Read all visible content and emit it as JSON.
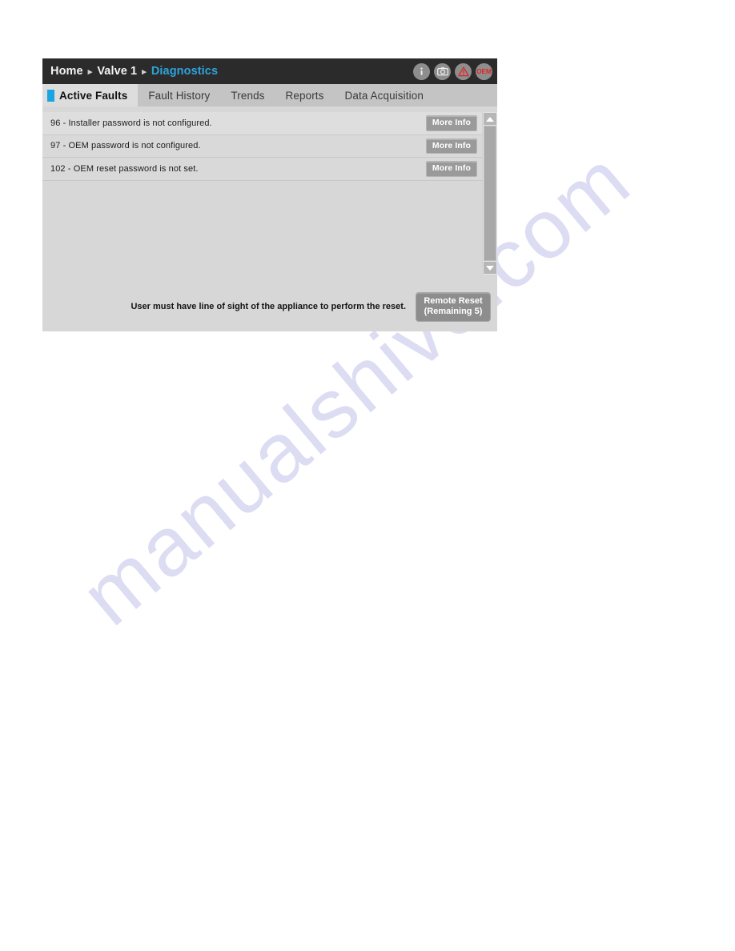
{
  "watermark": {
    "text": "manualshive.com"
  },
  "panel": {
    "breadcrumb": {
      "separator": "▸",
      "items": [
        {
          "label": "Home",
          "active": false
        },
        {
          "label": "Valve 1",
          "active": false
        },
        {
          "label": "Diagnostics",
          "active": true
        }
      ]
    },
    "title_icons": [
      {
        "name": "info-icon",
        "glyph": "i"
      },
      {
        "name": "camera-icon",
        "glyph": ""
      },
      {
        "name": "warning-triangle-icon",
        "glyph": "!"
      },
      {
        "name": "oem-badge-icon",
        "label": "OEM"
      }
    ],
    "tabs": [
      {
        "label": "Active Faults",
        "active": true
      },
      {
        "label": "Fault History",
        "active": false
      },
      {
        "label": "Trends",
        "active": false
      },
      {
        "label": "Reports",
        "active": false
      },
      {
        "label": "Data Acquisition",
        "active": false
      }
    ],
    "faults": [
      {
        "code": "96",
        "text": "96 - Installer password is not configured.",
        "action": "More Info"
      },
      {
        "code": "97",
        "text": "97 - OEM password is not configured.",
        "action": "More Info"
      },
      {
        "code": "102",
        "text": "102 - OEM reset password is not set.",
        "action": "More Info"
      }
    ],
    "footer": {
      "note": "User must have line of sight of the appliance to perform the reset.",
      "reset_button_line1": "Remote Reset",
      "reset_button_line2": "(Remaining 5)"
    },
    "colors": {
      "titlebar_bg": "#2b2b2b",
      "accent_cyan": "#1ba5e0",
      "panel_bg": "#d7d7d7",
      "tabbar_bg": "#c4c4c4",
      "active_tab_bg": "#dddddd",
      "button_gray": "#8d8d8d",
      "alert_red": "#e02626",
      "watermark_purple": "#cfcfee"
    }
  }
}
